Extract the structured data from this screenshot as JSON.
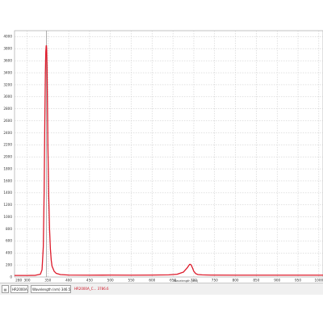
{
  "chart_data": {
    "type": "line",
    "title": "",
    "xlabel": "Wavelength (nm)",
    "ylabel": "",
    "xlim": [
      270,
      1010
    ],
    "ylim": [
      0,
      4100
    ],
    "x_ticks": [
      280,
      300,
      350,
      400,
      450,
      500,
      550,
      600,
      650,
      700,
      750,
      800,
      850,
      900,
      950,
      1000
    ],
    "y_ticks": [
      0,
      200,
      400,
      600,
      800,
      1000,
      1200,
      1400,
      1600,
      1800,
      2000,
      2200,
      2400,
      2600,
      2800,
      3000,
      3200,
      3400,
      3600,
      3800,
      4000
    ],
    "grid": true,
    "marker_x": 346.5,
    "series": [
      {
        "color": "#dd1a2a",
        "x": [
          270,
          280,
          300,
          320,
          332,
          336,
          339,
          341,
          342.5,
          344,
          345,
          346,
          346.5,
          347,
          348,
          349,
          350,
          352,
          354,
          356,
          358,
          360,
          365,
          370,
          380,
          400,
          450,
          500,
          550,
          600,
          640,
          660,
          675,
          684,
          688,
          690,
          692,
          694,
          697,
          700,
          705,
          710,
          720,
          740,
          800,
          900,
          1010
        ],
        "y": [
          25,
          25,
          25,
          28,
          45,
          120,
          500,
          1400,
          2500,
          3400,
          3750,
          3850,
          3850,
          3800,
          3500,
          2900,
          2200,
          1350,
          800,
          470,
          280,
          180,
          95,
          60,
          40,
          32,
          30,
          32,
          30,
          32,
          35,
          45,
          80,
          150,
          190,
          210,
          210,
          195,
          150,
          95,
          55,
          40,
          35,
          32,
          30,
          30,
          30
        ]
      }
    ]
  },
  "status_bar": {
    "icon": "document-icon",
    "series_field": "HR2000A_C...",
    "wavelength_field": "Wavelength (nm) 346.5",
    "readout": "HR2000A_C... 3786.6"
  }
}
